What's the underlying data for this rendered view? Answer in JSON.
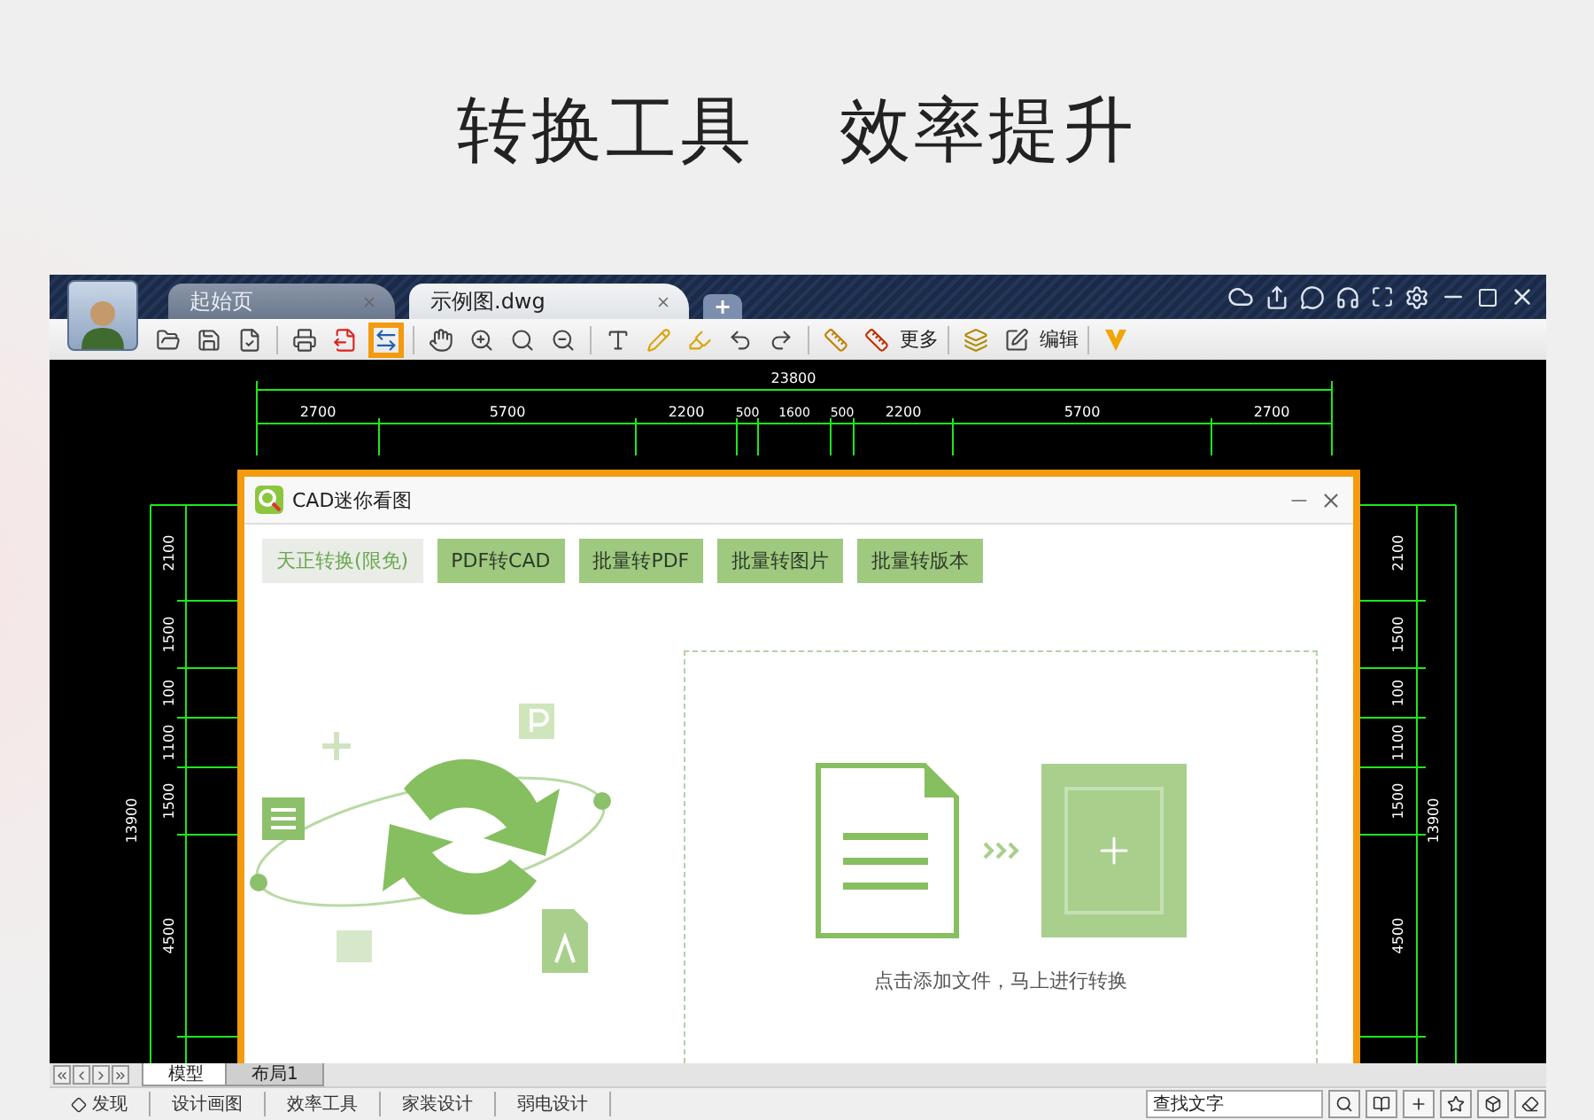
{
  "headline": [
    "转换工具",
    "效率提升"
  ],
  "window": {
    "tabs": [
      {
        "label": "起始页",
        "selected": false
      },
      {
        "label": "示例图.dwg",
        "selected": true
      }
    ],
    "new_tab": "+"
  },
  "toolbar": {
    "convert_highlighted": true,
    "more_label": "更多",
    "edit_label": "编辑"
  },
  "drawing": {
    "top_total": "23800",
    "top_dims": [
      "2700",
      "5700",
      "2200",
      "500",
      "1600",
      "500",
      "2200",
      "5700",
      "2700"
    ],
    "left_total": "13900",
    "left_dims": [
      "2100",
      "1500",
      "100",
      "1100",
      "1500",
      "4500"
    ],
    "right_total": "13900",
    "right_dims": [
      "2100",
      "1500",
      "100",
      "1100",
      "1500",
      "4500"
    ]
  },
  "dialog": {
    "title": "CAD迷你看图",
    "tabs": [
      {
        "label": "天正转换(限免)",
        "selected": true
      },
      {
        "label": "PDF转CAD",
        "selected": false
      },
      {
        "label": "批量转PDF",
        "selected": false
      },
      {
        "label": "批量转图片",
        "selected": false
      },
      {
        "label": "批量转版本",
        "selected": false
      }
    ],
    "drop_hint": "点击添加文件，马上进行转换"
  },
  "layout_tabs": [
    {
      "label": "模型",
      "selected": true
    },
    {
      "label": "布局1",
      "selected": false
    }
  ],
  "status_bar": {
    "items": [
      "发现",
      "设计画图",
      "效率工具",
      "家装设计",
      "弱电设计"
    ],
    "search": {
      "placeholder": "查找文字"
    }
  }
}
